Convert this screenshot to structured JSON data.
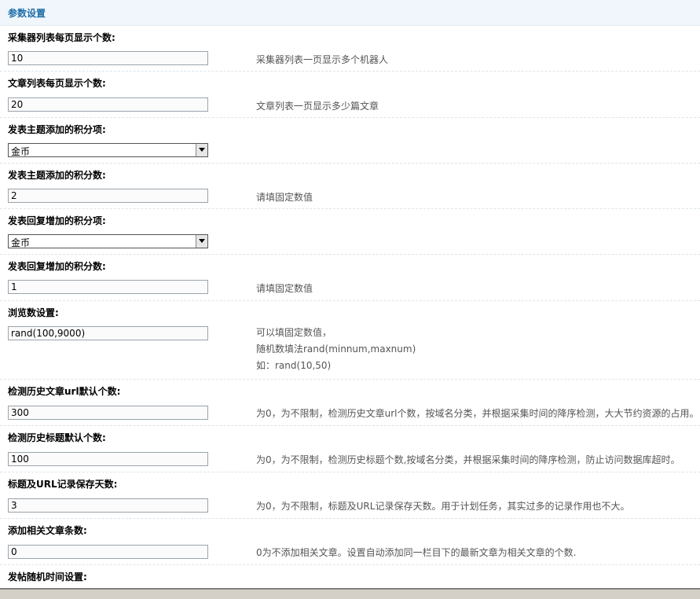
{
  "header": {
    "title": "参数设置"
  },
  "fields": [
    {
      "label": "采集器列表每页显示个数:",
      "type": "text",
      "value": "10",
      "hint": "采集器列表一页显示多个机器人"
    },
    {
      "label": "文章列表每页显示个数:",
      "type": "text",
      "value": "20",
      "hint": "文章列表一页显示多少篇文章"
    },
    {
      "label": "发表主题添加的积分项:",
      "type": "select",
      "value": "金币"
    },
    {
      "label": "发表主题添加的积分数:",
      "type": "text",
      "value": "2",
      "hint": "请填固定数值"
    },
    {
      "label": "发表回复增加的积分项:",
      "type": "select",
      "value": "金币"
    },
    {
      "label": "发表回复增加的积分数:",
      "type": "text",
      "value": "1",
      "hint": "请填固定数值"
    },
    {
      "label": "浏览数设置:",
      "type": "text",
      "value": "rand(100,9000)",
      "hint_lines": [
        "可以填固定数值，",
        "随机数填法rand(minnum,maxnum)",
        "如：rand(10,50)"
      ]
    },
    {
      "label": "检测历史文章url默认个数:",
      "type": "text",
      "value": "300",
      "hint": "为0，为不限制，检测历史文章url个数，按域名分类，并根据采集时间的降序检测，大大节约资源的占用。"
    },
    {
      "label": "检测历史标题默认个数:",
      "type": "text",
      "value": "100",
      "hint": "为0，为不限制，检测历史标题个数,按域名分类，并根据采集时间的降序检测，防止访问数据库超时。"
    },
    {
      "label": "标题及URL记录保存天数:",
      "type": "text",
      "value": "3",
      "hint": "为0，为不限制，标题及URL记录保存天数。用于计划任务，其实过多的记录作用也不大。"
    },
    {
      "label": "添加相关文章条数:",
      "type": "text",
      "value": "0",
      "hint": "0为不添加相关文章。设置自动添加同一栏目下的最新文章为相关文章的个数."
    },
    {
      "label": "发帖随机时间设置:",
      "type": "none"
    }
  ]
}
